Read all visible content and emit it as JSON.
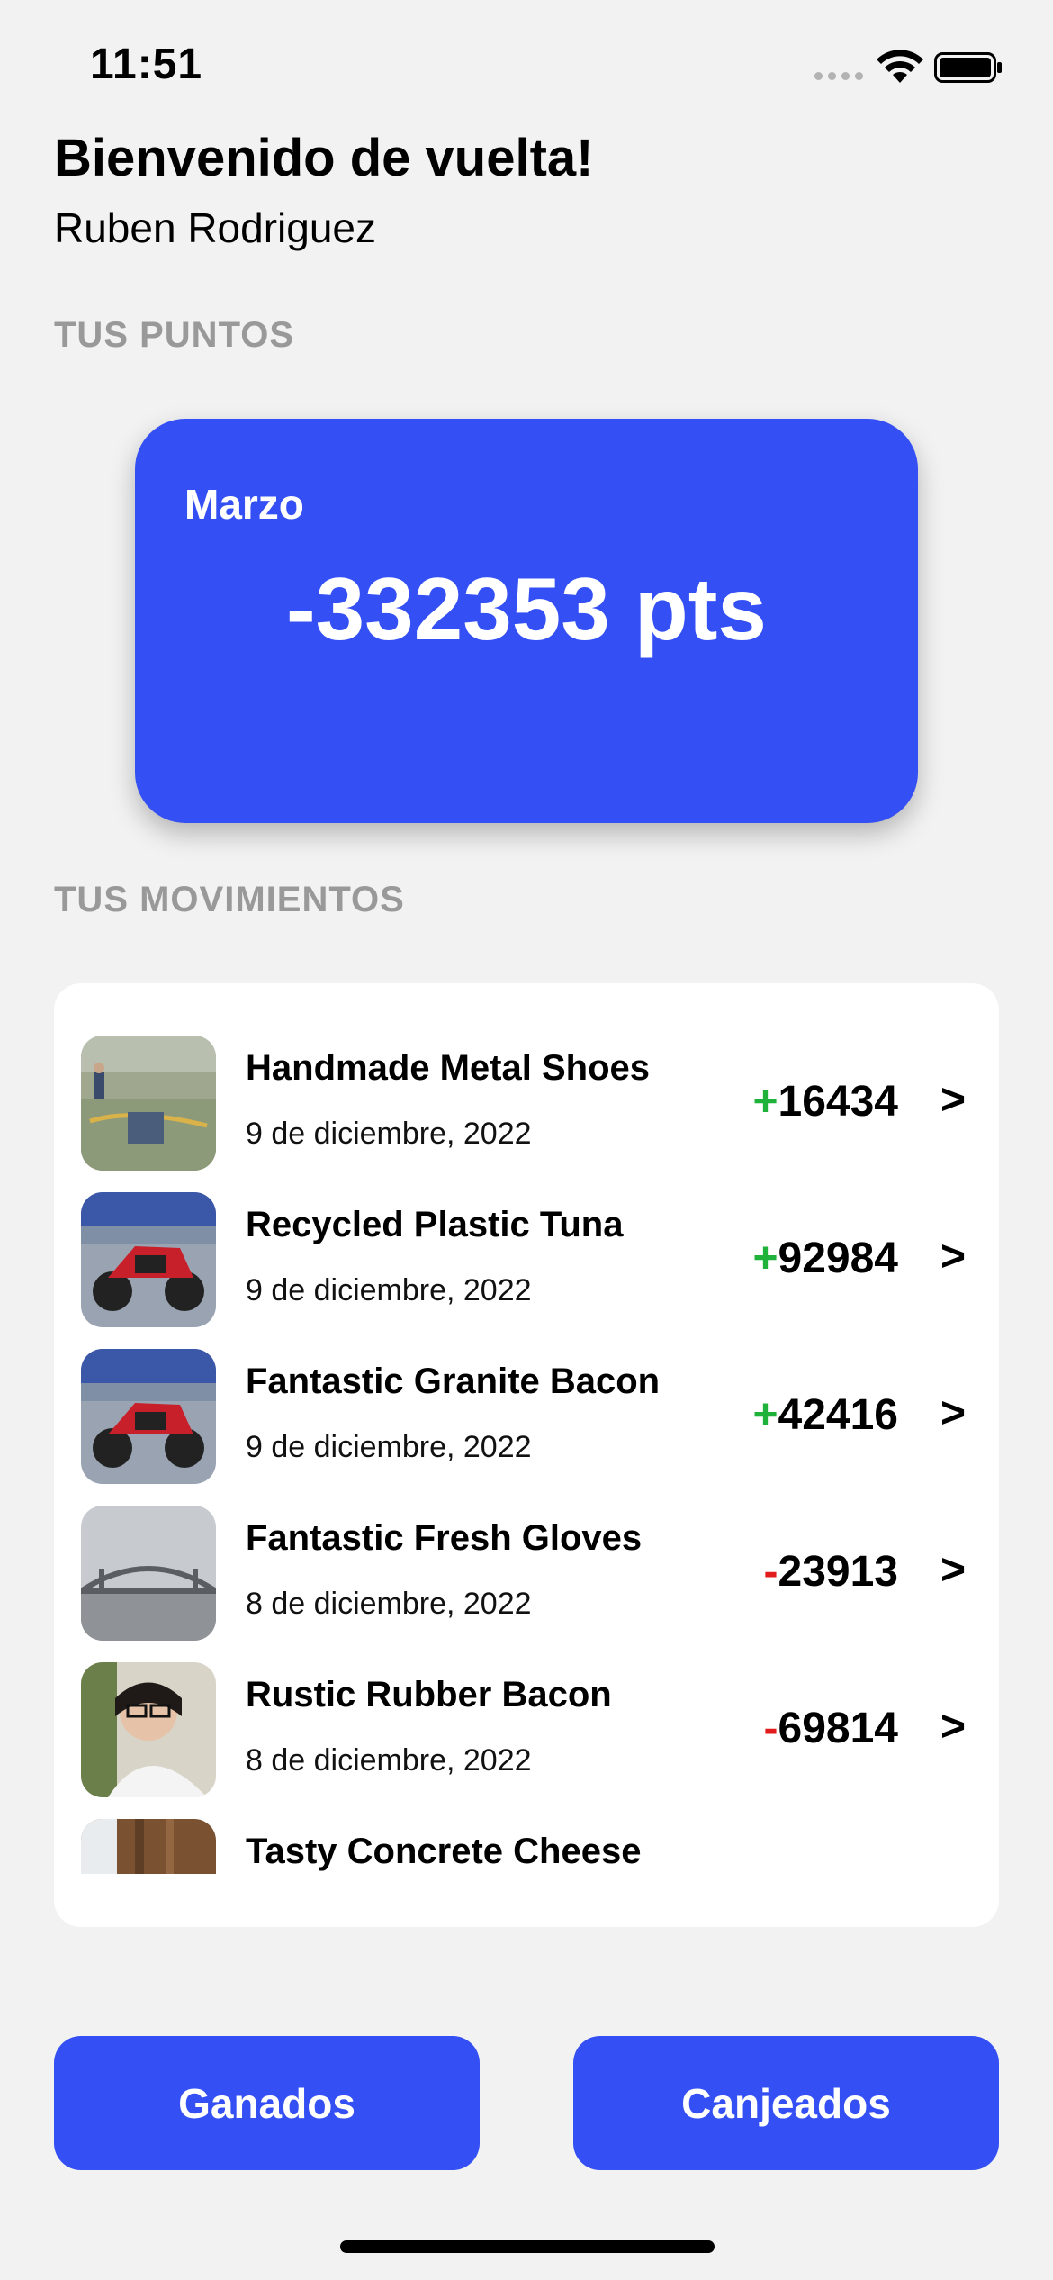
{
  "status_bar": {
    "time": "11:51"
  },
  "header": {
    "title": "Bienvenido de vuelta!",
    "user_name": "Ruben Rodriguez"
  },
  "points_section": {
    "label": "TUS PUNTOS",
    "month": "Marzo",
    "points": "-332353 pts"
  },
  "moves_section": {
    "label": "TUS MOVIMIENTOS",
    "items": [
      {
        "name": "Handmade Metal Shoes",
        "date": "9 de diciembre, 2022",
        "sign": "+",
        "amount": "16434",
        "thumb": "beach"
      },
      {
        "name": "Recycled Plastic Tuna",
        "date": "9 de diciembre, 2022",
        "sign": "+",
        "amount": "92984",
        "thumb": "motorcycle"
      },
      {
        "name": "Fantastic Granite Bacon",
        "date": "9 de diciembre, 2022",
        "sign": "+",
        "amount": "42416",
        "thumb": "motorcycle"
      },
      {
        "name": "Fantastic Fresh Gloves",
        "date": "8 de diciembre, 2022",
        "sign": "-",
        "amount": "23913",
        "thumb": "bridge"
      },
      {
        "name": "Rustic Rubber Bacon",
        "date": "8 de diciembre, 2022",
        "sign": "-",
        "amount": "69814",
        "thumb": "person"
      },
      {
        "name": "Tasty Concrete Cheese",
        "date": "",
        "sign": "",
        "amount": "",
        "thumb": "wood"
      }
    ],
    "chevron": ">"
  },
  "buttons": {
    "earned": "Ganados",
    "redeemed": "Canjeados"
  },
  "colors": {
    "accent": "#3450f5",
    "positive": "#1fb23a",
    "negative": "#e21c1c",
    "background": "#f2f2f2"
  }
}
